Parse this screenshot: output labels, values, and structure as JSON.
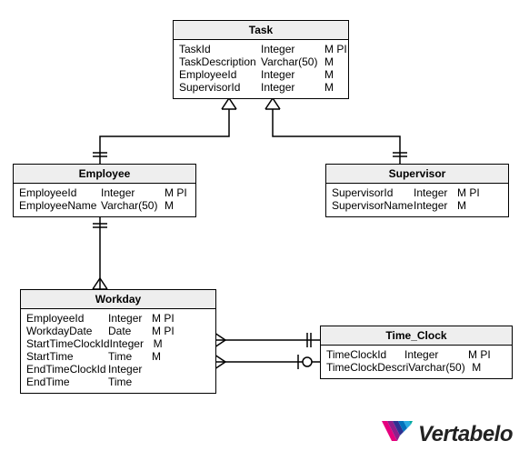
{
  "entities": {
    "task": {
      "title": "Task",
      "rows": [
        {
          "name": "TaskId",
          "type": "Integer",
          "flags": "M PI"
        },
        {
          "name": "TaskDescription",
          "type": "Varchar(50)",
          "flags": "M"
        },
        {
          "name": "EmployeeId",
          "type": "Integer",
          "flags": "M"
        },
        {
          "name": "SupervisorId",
          "type": "Integer",
          "flags": "M"
        }
      ]
    },
    "employee": {
      "title": "Employee",
      "rows": [
        {
          "name": "EmployeeId",
          "type": "Integer",
          "flags": "M PI"
        },
        {
          "name": "EmployeeName",
          "type": "Varchar(50)",
          "flags": "M"
        }
      ]
    },
    "supervisor": {
      "title": "Supervisor",
      "rows": [
        {
          "name": "SupervisorId",
          "type": "Integer",
          "flags": "M PI"
        },
        {
          "name": "SupervisorName",
          "type": "Integer",
          "flags": "M"
        }
      ]
    },
    "workday": {
      "title": "Workday",
      "rows": [
        {
          "name": "EmployeeId",
          "type": "Integer",
          "flags": "M PI"
        },
        {
          "name": "WorkdayDate",
          "type": "Date",
          "flags": "M PI"
        },
        {
          "name": "StartTimeClockId",
          "type": "Integer",
          "flags": "M"
        },
        {
          "name": "StartTime",
          "type": "Time",
          "flags": "M"
        },
        {
          "name": "EndTimeClockId",
          "type": "Integer",
          "flags": ""
        },
        {
          "name": "EndTime",
          "type": "Time",
          "flags": ""
        }
      ]
    },
    "timeclock": {
      "title": "Time_Clock",
      "rows": [
        {
          "name": "TimeClockId",
          "type": "Integer",
          "flags": "M PI"
        },
        {
          "name": "TimeClockDescri",
          "type": "Varchar(50)",
          "flags": "M"
        }
      ]
    }
  },
  "logo_text": "Vertabelo"
}
